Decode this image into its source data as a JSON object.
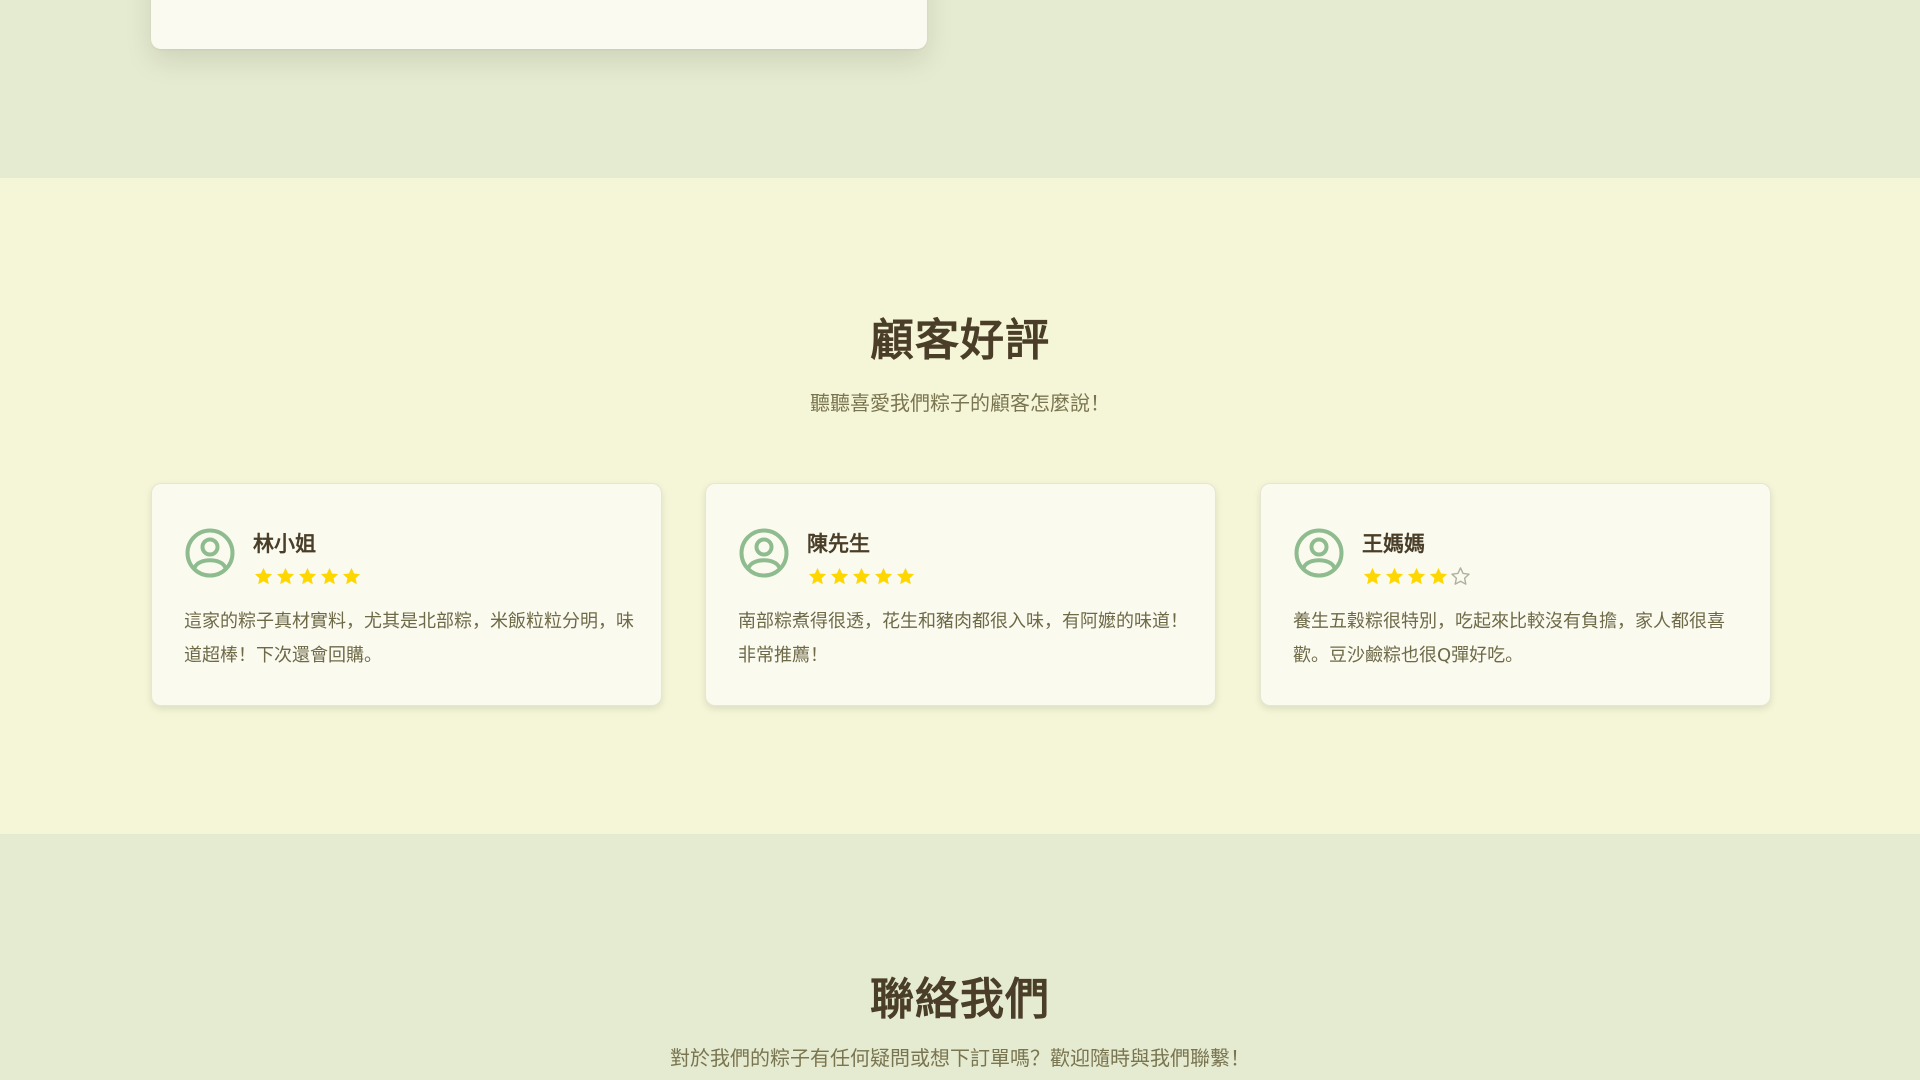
{
  "colors": {
    "accent": "#ffd700",
    "heading": "#4a3e29",
    "muted_text": "#7a7551",
    "avatar_green": "#8fbc8f",
    "star_gold": "#ffd700",
    "star_empty": "#b0b0a0"
  },
  "reviews": {
    "title": "顧客好評",
    "subtitle": "聽聽喜愛我們粽子的顧客怎麼說！",
    "items": [
      {
        "name": "林小姐",
        "rating": 5,
        "text": "這家的粽子真材實料，尤其是北部粽，米飯粒粒分明，味道超棒！下次還會回購。"
      },
      {
        "name": "陳先生",
        "rating": 5,
        "text": "南部粽煮得很透，花生和豬肉都很入味，有阿嬤的味道！非常推薦！"
      },
      {
        "name": "王媽媽",
        "rating": 4,
        "text": "養生五穀粽很特別，吃起來比較沒有負擔，家人都很喜歡。豆沙鹼粽也很Q彈好吃。"
      }
    ]
  },
  "contact": {
    "title": "聯絡我們",
    "subtitle": "對於我們的粽子有任何疑問或想下訂單嗎？歡迎隨時與我們聯繫！"
  }
}
